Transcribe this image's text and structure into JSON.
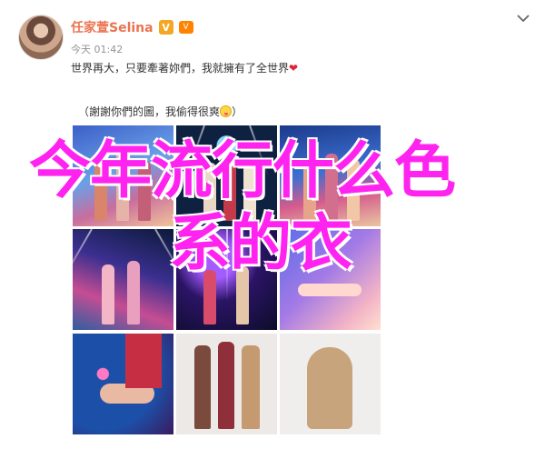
{
  "post": {
    "user_name": "任家萱Selina",
    "verified_badge": "V",
    "vip_badge": "V",
    "timestamp": "今天 01:42",
    "text_line1": "世界再大，只要牽著妳們，我就擁有了全世界",
    "text_line2": "（謝謝你們的圖，我偷得很爽",
    "text_line2_end": "）",
    "heart_icon": "❤",
    "emoji_icon": "tongue-out-emoji"
  },
  "overlay": {
    "line1": "今年流行什么色",
    "line2": "系的衣"
  },
  "colors": {
    "name": "#eb7350",
    "overlay_text": "#ff23f0",
    "heart": "#e0243a"
  }
}
